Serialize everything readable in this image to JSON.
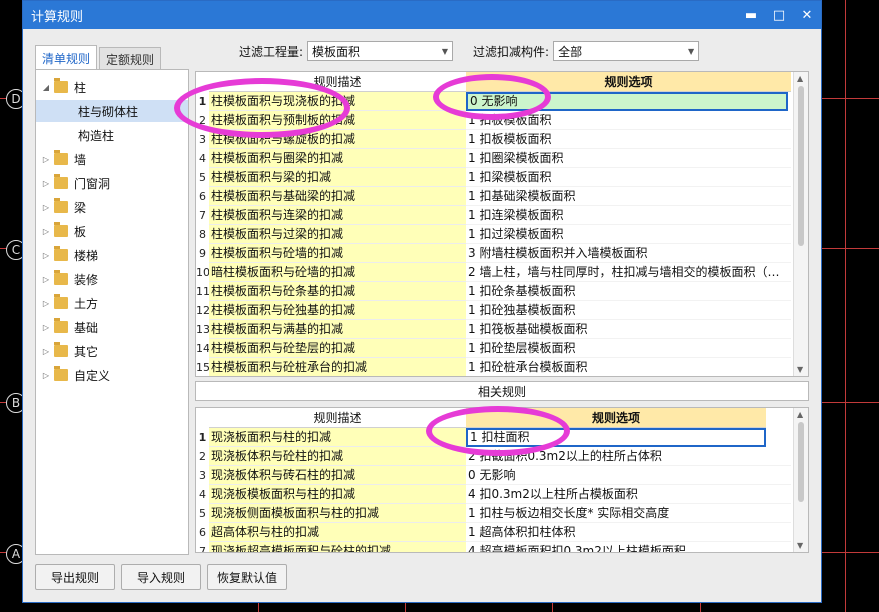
{
  "dialog": {
    "title": "计算规则",
    "minimize_label": "▬",
    "maximize_label": "□",
    "close_label": "✕"
  },
  "background_axis_labels": [
    "D",
    "C",
    "B",
    "A"
  ],
  "tabs": [
    {
      "label": "清单规则",
      "active": true
    },
    {
      "label": "定额规则",
      "active": false
    }
  ],
  "filters": {
    "quantity_label": "过滤工程量:",
    "quantity_value": "模板面积",
    "component_label": "过滤扣减构件:",
    "component_value": "全部"
  },
  "tree": [
    {
      "label": "柱",
      "expanded": true,
      "folder": true
    },
    {
      "label": "柱与砌体柱",
      "selected": true,
      "child": true
    },
    {
      "label": "构造柱",
      "child": true
    },
    {
      "label": "墙",
      "folder": true
    },
    {
      "label": "门窗洞",
      "folder": true
    },
    {
      "label": "梁",
      "folder": true
    },
    {
      "label": "板",
      "folder": true
    },
    {
      "label": "楼梯",
      "folder": true
    },
    {
      "label": "装修",
      "folder": true
    },
    {
      "label": "土方",
      "folder": true
    },
    {
      "label": "基础",
      "folder": true
    },
    {
      "label": "其它",
      "folder": true
    },
    {
      "label": "自定义",
      "folder": true
    }
  ],
  "top_grid": {
    "headers": {
      "desc": "规则描述",
      "opt": "规则选项"
    },
    "rows": [
      {
        "n": "1",
        "desc": "柱模板面积与现浇板的扣减",
        "opt": "0  无影响"
      },
      {
        "n": "2",
        "desc": "柱模板面积与预制板的扣减",
        "opt": "1  扣板模板面积"
      },
      {
        "n": "3",
        "desc": "柱模板面积与螺旋板的扣减",
        "opt": "1  扣板模板面积"
      },
      {
        "n": "4",
        "desc": "柱模板面积与圈梁的扣减",
        "opt": "1  扣圈梁模板面积"
      },
      {
        "n": "5",
        "desc": "柱模板面积与梁的扣减",
        "opt": "1  扣梁模板面积"
      },
      {
        "n": "6",
        "desc": "柱模板面积与基础梁的扣减",
        "opt": "1  扣基础梁模板面积"
      },
      {
        "n": "7",
        "desc": "柱模板面积与连梁的扣减",
        "opt": "1  扣连梁模板面积"
      },
      {
        "n": "8",
        "desc": "柱模板面积与过梁的扣减",
        "opt": "1  扣过梁模板面积"
      },
      {
        "n": "9",
        "desc": "柱模板面积与砼墙的扣减",
        "opt": "3  附墙柱模板面积并入墙模板面积"
      },
      {
        "n": "10",
        "desc": "暗柱模板面积与砼墙的扣减",
        "opt": "2  墙上柱，墙与柱同厚时，柱扣减与墙相交的模板面积（…"
      },
      {
        "n": "11",
        "desc": "柱模板面积与砼条基的扣减",
        "opt": "1  扣砼条基模板面积"
      },
      {
        "n": "12",
        "desc": "柱模板面积与砼独基的扣减",
        "opt": "1  扣砼独基模板面积"
      },
      {
        "n": "13",
        "desc": "柱模板面积与满基的扣减",
        "opt": "1  扣筏板基础模板面积"
      },
      {
        "n": "14",
        "desc": "柱模板面积与砼垫层的扣减",
        "opt": "1  扣砼垫层模板面积"
      },
      {
        "n": "15",
        "desc": "柱模板面积与砼桩承台的扣减",
        "opt": "1  扣砼桩承台模板面积"
      }
    ]
  },
  "related_rules_label": "相关规则",
  "bottom_grid": {
    "headers": {
      "desc": "规则描述",
      "opt": "规则选项"
    },
    "rows": [
      {
        "n": "1",
        "desc": "现浇板面积与柱的扣减",
        "opt": "1  扣柱面积"
      },
      {
        "n": "2",
        "desc": "现浇板体积与砼柱的扣减",
        "opt": "2  扣截面积0.3m2以上的柱所占体积"
      },
      {
        "n": "3",
        "desc": "现浇板体积与砖石柱的扣减",
        "opt": "0  无影响"
      },
      {
        "n": "4",
        "desc": "现浇板模板面积与柱的扣减",
        "opt": "4  扣0.3m2以上柱所占模板面积"
      },
      {
        "n": "5",
        "desc": "现浇板侧面模板面积与柱的扣减",
        "opt": "1  扣柱与板边相交长度* 实际相交高度"
      },
      {
        "n": "6",
        "desc": "超高体积与柱的扣减",
        "opt": "1  超高体积扣柱体积"
      },
      {
        "n": "7",
        "desc": "现浇板超高模板面积与砼柱的扣减",
        "opt": "4  超高模板面积扣0.3m2以上柱模板面积"
      }
    ]
  },
  "buttons": {
    "export": "导出规则",
    "import": "导入规则",
    "restore": "恢复默认值"
  },
  "colors": {
    "titlebar": "#2b78d6",
    "desc_bg": "#ffffb8",
    "header_highlight": "#ffe9a8",
    "selected_cell": "#ccf5cc",
    "annotation": "#e63bd6"
  }
}
